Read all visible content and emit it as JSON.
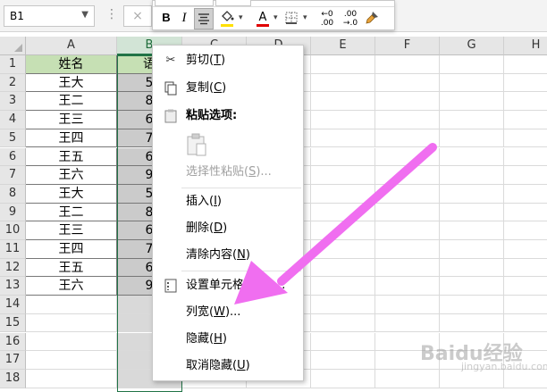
{
  "name_box": "B1",
  "formula_cancel": "×",
  "mini_toolbar": {
    "bold": "B",
    "italic": "I",
    "font_color_glyph": "A",
    "inc_decimal_top": "←0",
    "inc_decimal_bottom": ".00",
    "dec_decimal_top": ".00",
    "dec_decimal_bottom": "→.0"
  },
  "columns": [
    "A",
    "B",
    "C",
    "D",
    "E",
    "F",
    "G",
    "H"
  ],
  "rows": [
    "1",
    "2",
    "3",
    "4",
    "5",
    "6",
    "7",
    "8",
    "9",
    "10",
    "11",
    "12",
    "13",
    "14",
    "15",
    "16",
    "17",
    "18"
  ],
  "table": {
    "col_a": [
      "姓名",
      "王大",
      "王二",
      "王三",
      "王四",
      "王五",
      "王六",
      "王大",
      "王二",
      "王三",
      "王四",
      "王五",
      "王六"
    ],
    "col_b": [
      "语",
      "5",
      "8",
      "6",
      "7",
      "6",
      "9",
      "5",
      "8",
      "6",
      "7",
      "6",
      "9"
    ]
  },
  "context_menu": {
    "cut": {
      "label": "剪切(",
      "key": "T",
      "end": ")"
    },
    "copy": {
      "label": "复制(",
      "key": "C",
      "end": ")"
    },
    "paste_options": "粘贴选项:",
    "paste_special": {
      "label": "选择性粘贴(",
      "key": "S",
      "end": ")..."
    },
    "insert": {
      "label": "插入(",
      "key": "I",
      "end": ")"
    },
    "delete": {
      "label": "删除(",
      "key": "D",
      "end": ")"
    },
    "clear": {
      "label": "清除内容(",
      "key": "N",
      "end": ")"
    },
    "format_cells": {
      "label": "设置单元格",
      "end": "..."
    },
    "column_width": {
      "label": "列宽(",
      "key": "W",
      "end": ")..."
    },
    "hide": {
      "label": "隐藏(",
      "key": "H",
      "end": ")"
    },
    "unhide": {
      "label": "取消隐藏(",
      "key": "U",
      "end": ")"
    }
  },
  "watermark": {
    "text": "Baidu经验",
    "sub": "jingyan.baidu.com"
  },
  "colors": {
    "header_fill": "#c6e0b4",
    "selection_green": "#217346",
    "arrow": "#f06ef0"
  }
}
